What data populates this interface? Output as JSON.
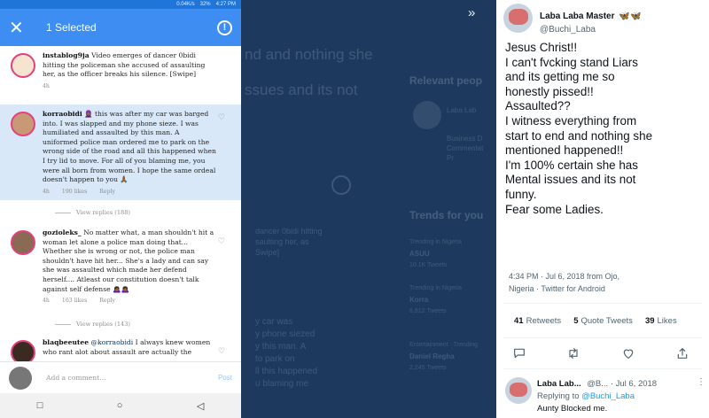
{
  "phone": {
    "status": {
      "network": "0.04K/s",
      "battery": "32%",
      "time": "4:27 PM"
    },
    "selbar": {
      "close_glyph": "✕",
      "title": "1 Selected",
      "info_glyph": "!"
    },
    "comments": [
      {
        "user": "instablog9ja",
        "text": "Video emerges of dancer 0bidi hitting the policeman she accused of assaulting her, as the officer breaks his silence. [Swipe]",
        "time": "4h",
        "likes": "",
        "reply": ""
      },
      {
        "user": "korraobidi",
        "text": "🧕🏾 this was after my car was barged into. I was slapped and my phone sieze. I was humiliated and assaulted by this man. A uniformed police man ordered me to park on the wrong side of the road and all this happened when I try lid to move. For all of you blaming me, you were all born from women. I hope the same ordeal doesn't happen to you 🙏🏾",
        "time": "4h",
        "likes": "190 likes",
        "reply": "Reply"
      },
      {
        "user": "gozioleks_",
        "text": "No matter what, a man shouldn't hit a woman let alone a police man doing that... Whether she is wrong or not, the police man shouldn't have hit her... She's a lady and can say she was assaulted which made her defend herself.... Atleast our constitution doesn't talk against self defense 🙇🏾‍♀️🙇🏾‍♀️",
        "time": "4h",
        "likes": "163 likes",
        "reply": "Reply"
      },
      {
        "user": "blaqbeeutee",
        "mention": "@korraobidi",
        "text": "I always knew women who rant alot about assault are actually the",
        "time": "",
        "likes": "",
        "reply": ""
      }
    ],
    "view_replies": [
      "View replies (188)",
      "View replies (143)"
    ],
    "add_comment": "Add a comment...",
    "post": "Post",
    "nav": [
      "□",
      "○",
      "◁"
    ]
  },
  "middle": {
    "chevron": "»",
    "ghost": {
      "line1": "nd and nothing she",
      "line2": "ssues and its not",
      "relevant": "Relevant peop",
      "name": "Laba Lab",
      "bio1": "Business D",
      "bio2": "Commentat",
      "bio3": "Pr",
      "trends": "Trends for you",
      "dancer1": "dancer 0bidi hitting",
      "dancer2": "saulting her, as",
      "swipe": "Swipe]",
      "t1cat": "Trending in Nigeria",
      "t1": "ASUU",
      "t1c": "10.1K Tweets",
      "t2cat": "Trending in Nigeria",
      "t2": "Korra",
      "t2c": "6,812 Tweets",
      "t3cat": "Entertainment · Trending",
      "t3": "Daniel Regha",
      "t3c": "2,245 Tweets",
      "car1": "y car was",
      "car2": "y phone siezed",
      "car3": "y this man. A",
      "car4": "to park on",
      "car5": "ll this happened",
      "car6": "u blaming me"
    }
  },
  "tweet": {
    "display_name": "Laba Laba Master",
    "badges": "🦋🦋",
    "handle": "@Buchi_Laba",
    "body_lines": [
      "Jesus Christ!!",
      "I can't fvcking stand Liars",
      "and its getting me so",
      "honestly pissed!!",
      "Assaulted??",
      "I witness everything from",
      "start to end and nothing she",
      "mentioned happened!!",
      "I'm 100% certain she has",
      "Mental issues and its not",
      "funny.",
      "Fear some Ladies."
    ],
    "meta_line1": "4:34 PM · Jul 6, 2018 from Ojo,",
    "meta_line2": "Nigeria · Twitter for Android",
    "stats": {
      "retweets_n": "41",
      "retweets_l": "Retweets",
      "quotes_n": "5",
      "quotes_l": "Quote Tweets",
      "likes_n": "39",
      "likes_l": "Likes"
    },
    "action_icons": [
      "comment-icon",
      "retweet-icon",
      "like-icon",
      "share-icon"
    ],
    "reply": {
      "name": "Laba Lab...",
      "handle": "@B...",
      "date": "· Jul 6, 2018",
      "replying_to": "Replying to",
      "replying_handle": "@Buchi_Laba",
      "text": "Aunty Blocked me.",
      "more": "⋮"
    }
  }
}
